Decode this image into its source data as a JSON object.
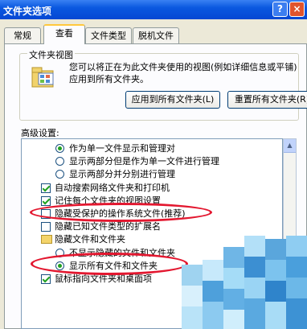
{
  "window": {
    "title": "文件夹选项",
    "help_glyph": "?",
    "close_glyph": "×"
  },
  "tabs": [
    {
      "label": "常规",
      "active": false
    },
    {
      "label": "查看",
      "active": true
    },
    {
      "label": "文件类型",
      "active": false
    },
    {
      "label": "脱机文件",
      "active": false
    }
  ],
  "folder_views": {
    "title": "文件夹视图",
    "description": "您可以将正在为此文件夹使用的视图(例如详细信息或平铺)应用到所有文件夹。",
    "apply_button": "应用到所有文件夹(L)",
    "reset_button": "重置所有文件夹(R)"
  },
  "advanced": {
    "label": "高级设置:",
    "items": [
      {
        "kind": "radio",
        "checked": true,
        "indent": 2,
        "label": "作为单一文件显示和管理对"
      },
      {
        "kind": "radio",
        "checked": false,
        "indent": 2,
        "label": "显示两部分但是作为单一文件进行管理"
      },
      {
        "kind": "radio",
        "checked": false,
        "indent": 2,
        "label": "显示两部分并分别进行管理"
      },
      {
        "kind": "check",
        "checked": true,
        "indent": 1,
        "label": "自动搜索网络文件夹和打印机"
      },
      {
        "kind": "check",
        "checked": true,
        "indent": 1,
        "label": "记住每个文件夹的视图设置"
      },
      {
        "kind": "check",
        "checked": false,
        "indent": 1,
        "label": "隐藏受保护的操作系统文件(推荐)"
      },
      {
        "kind": "check",
        "checked": false,
        "indent": 1,
        "label": "隐藏已知文件类型的扩展名"
      },
      {
        "kind": "folder",
        "checked": false,
        "indent": 1,
        "label": "隐藏文件和文件夹"
      },
      {
        "kind": "radio",
        "checked": false,
        "indent": 2,
        "label": "不显示隐藏的文件和文件夹"
      },
      {
        "kind": "radio",
        "checked": true,
        "indent": 2,
        "label": "显示所有文件和文件夹"
      },
      {
        "kind": "check",
        "checked": true,
        "indent": 1,
        "label": "鼠标指向文件夹和桌面项"
      }
    ]
  },
  "colors": {
    "title_bar": "#0a58e0",
    "annotation": "#e3172f",
    "dialog_bg": "#ece9d8"
  }
}
